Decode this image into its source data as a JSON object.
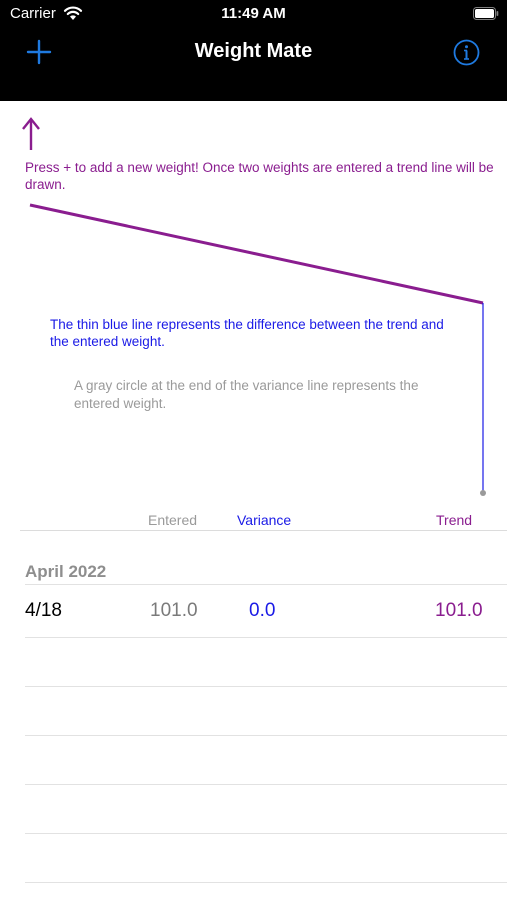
{
  "status_bar": {
    "carrier": "Carrier",
    "time": "11:49 AM"
  },
  "nav": {
    "title": "Weight Mate",
    "add_icon": "plus-icon",
    "info_icon": "info-icon"
  },
  "colors": {
    "trend": "#8a1d8f",
    "variance": "#1a1ae6",
    "entered": "#9a9a9a",
    "accent": "#1f7ae0"
  },
  "graph": {
    "hint_add": "Press + to add a new weight! Once two weights are entered a trend line will be drawn.",
    "hint_variance": "The thin blue line represents the difference between the trend and the entered weight.",
    "hint_circle": "A gray circle at the end of the variance line represents the entered weight."
  },
  "columns": {
    "entered": "Entered",
    "variance": "Variance",
    "trend": "Trend"
  },
  "sections": [
    {
      "header": "April 2022",
      "rows": [
        {
          "date": "4/18",
          "entered": "101.0",
          "variance": "0.0",
          "trend": "101.0"
        }
      ]
    }
  ]
}
